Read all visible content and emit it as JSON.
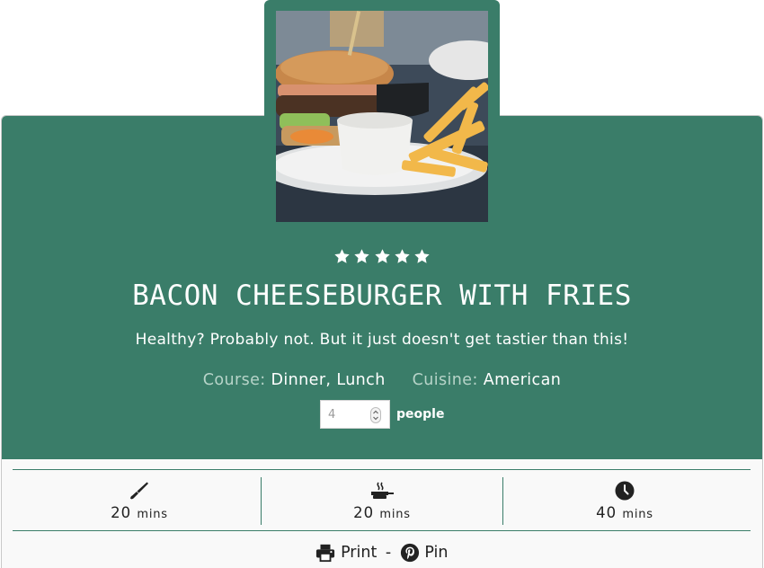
{
  "recipe": {
    "rating": 5,
    "rating_max": 5,
    "title": "BACON CHEESEBURGER WITH FRIES",
    "summary": "Healthy? Probably not. But it just doesn't get tastier than this!",
    "course_label": "Course:",
    "course_value": "Dinner, Lunch",
    "cuisine_label": "Cuisine:",
    "cuisine_value": "American",
    "servings_value": "4",
    "servings_unit": "people"
  },
  "times": [
    {
      "icon": "knife-icon",
      "amount": "20",
      "unit": "mins"
    },
    {
      "icon": "pan-icon",
      "amount": "20",
      "unit": "mins"
    },
    {
      "icon": "clock-icon",
      "amount": "40",
      "unit": "mins"
    }
  ],
  "actions": {
    "print_label": "Print",
    "separator": "-",
    "pin_label": "Pin"
  },
  "colors": {
    "accent": "#3a7d69",
    "text_on_accent": "#ffffff",
    "meta_label": "#b7d4c9"
  }
}
